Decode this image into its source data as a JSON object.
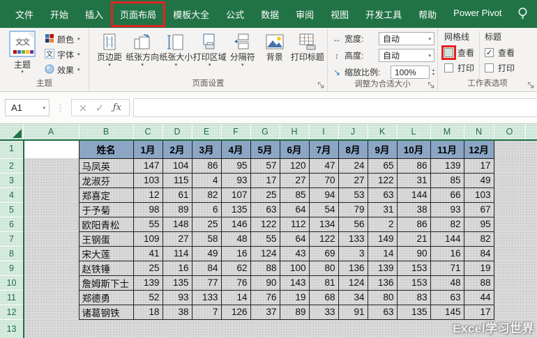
{
  "tab_bar": {
    "tabs": [
      "文件",
      "开始",
      "插入",
      "页面布局",
      "模板大全",
      "公式",
      "数据",
      "审阅",
      "视图",
      "开发工具",
      "帮助",
      "Power Pivot"
    ],
    "active_tab": "页面布局",
    "annotated_tab": "页面布局"
  },
  "ribbon": {
    "themes": {
      "group_label": "主题",
      "big_button": "主题",
      "big_icon_text": "文文",
      "small_buttons": [
        {
          "icon": "colors-icon",
          "label": "颜色"
        },
        {
          "icon": "fonts-icon",
          "label": "字体"
        },
        {
          "icon": "effects-icon",
          "label": "效果"
        }
      ]
    },
    "page_setup": {
      "group_label": "页面设置",
      "buttons": [
        {
          "icon": "margins-icon",
          "label": "页边距",
          "dropdown": true
        },
        {
          "icon": "orientation-icon",
          "label": "纸张方向",
          "dropdown": true
        },
        {
          "icon": "size-icon",
          "label": "纸张大小",
          "dropdown": true
        },
        {
          "icon": "print-area-icon",
          "label": "打印区域",
          "dropdown": true
        },
        {
          "icon": "breaks-icon",
          "label": "分隔符",
          "dropdown": true
        },
        {
          "icon": "background-icon",
          "label": "背景",
          "dropdown": false
        },
        {
          "icon": "print-titles-icon",
          "label": "打印标题",
          "dropdown": false
        }
      ]
    },
    "scale_to_fit": {
      "group_label": "调整为合适大小",
      "rows": [
        {
          "icon": "width-icon",
          "label": "宽度:",
          "value": "自动",
          "control": "dropdown"
        },
        {
          "icon": "height-icon",
          "label": "高度:",
          "value": "自动",
          "control": "dropdown"
        },
        {
          "icon": "scale-icon",
          "label": "缩放比例:",
          "value": "100%",
          "control": "spinner"
        }
      ]
    },
    "sheet_options": {
      "group_label": "工作表选项",
      "columns": [
        {
          "header": "网格线",
          "checkboxes": [
            {
              "label": "查看",
              "checked": false,
              "annotated": true
            },
            {
              "label": "打印",
              "checked": false,
              "annotated": false
            }
          ]
        },
        {
          "header": "标题",
          "checkboxes": [
            {
              "label": "查看",
              "checked": true,
              "annotated": false
            },
            {
              "label": "打印",
              "checked": false,
              "annotated": false
            }
          ]
        }
      ]
    }
  },
  "formula_bar": {
    "name_box": "A1",
    "cancel_icon": "×",
    "enter_icon": "✓",
    "fx_icon": "ƒx"
  },
  "grid": {
    "column_letters": [
      "A",
      "B",
      "C",
      "D",
      "E",
      "F",
      "G",
      "H",
      "I",
      "J",
      "K",
      "L",
      "M",
      "N",
      "O"
    ],
    "row_count": 13,
    "active_cell": "A1",
    "table": {
      "headers": [
        "姓名",
        "1月",
        "2月",
        "3月",
        "4月",
        "5月",
        "6月",
        "7月",
        "8月",
        "9月",
        "10月",
        "11月",
        "12月"
      ],
      "rows": [
        {
          "name": "马凤英",
          "values": [
            147,
            104,
            86,
            95,
            57,
            120,
            47,
            24,
            65,
            86,
            139,
            17
          ]
        },
        {
          "name": "龙淑芬",
          "values": [
            103,
            115,
            4,
            93,
            17,
            27,
            70,
            27,
            122,
            31,
            85,
            49
          ]
        },
        {
          "name": "郑喜定",
          "values": [
            12,
            61,
            82,
            107,
            25,
            85,
            94,
            53,
            63,
            144,
            66,
            103
          ]
        },
        {
          "name": "于予菊",
          "values": [
            98,
            89,
            6,
            135,
            63,
            64,
            54,
            79,
            31,
            38,
            93,
            67
          ]
        },
        {
          "name": "欧阳青松",
          "values": [
            55,
            148,
            25,
            146,
            122,
            112,
            134,
            56,
            2,
            86,
            82,
            95
          ]
        },
        {
          "name": "王钢蛋",
          "values": [
            109,
            27,
            58,
            48,
            55,
            64,
            122,
            133,
            149,
            21,
            144,
            82
          ]
        },
        {
          "name": "宋大莲",
          "values": [
            41,
            114,
            49,
            16,
            124,
            43,
            69,
            3,
            14,
            90,
            16,
            84
          ]
        },
        {
          "name": "赵铁锤",
          "values": [
            25,
            16,
            84,
            62,
            88,
            100,
            80,
            136,
            139,
            153,
            71,
            19
          ]
        },
        {
          "name": "詹姆斯下士",
          "values": [
            139,
            135,
            77,
            76,
            90,
            143,
            81,
            124,
            136,
            153,
            48,
            88
          ]
        },
        {
          "name": "郑德勇",
          "values": [
            52,
            93,
            133,
            14,
            76,
            19,
            68,
            34,
            80,
            83,
            63,
            44
          ]
        },
        {
          "name": "诸葛钢铁",
          "values": [
            18,
            38,
            7,
            126,
            37,
            89,
            33,
            91,
            63,
            135,
            145,
            17
          ]
        }
      ]
    }
  },
  "watermark": "Excel学习世界",
  "colors": {
    "excel_green": "#217346",
    "table_header_blue": "#8EA9C8",
    "annotation_red": "#E42320",
    "selection_gray": "#DADADA",
    "header_green_bg": "#D7ECE0"
  }
}
